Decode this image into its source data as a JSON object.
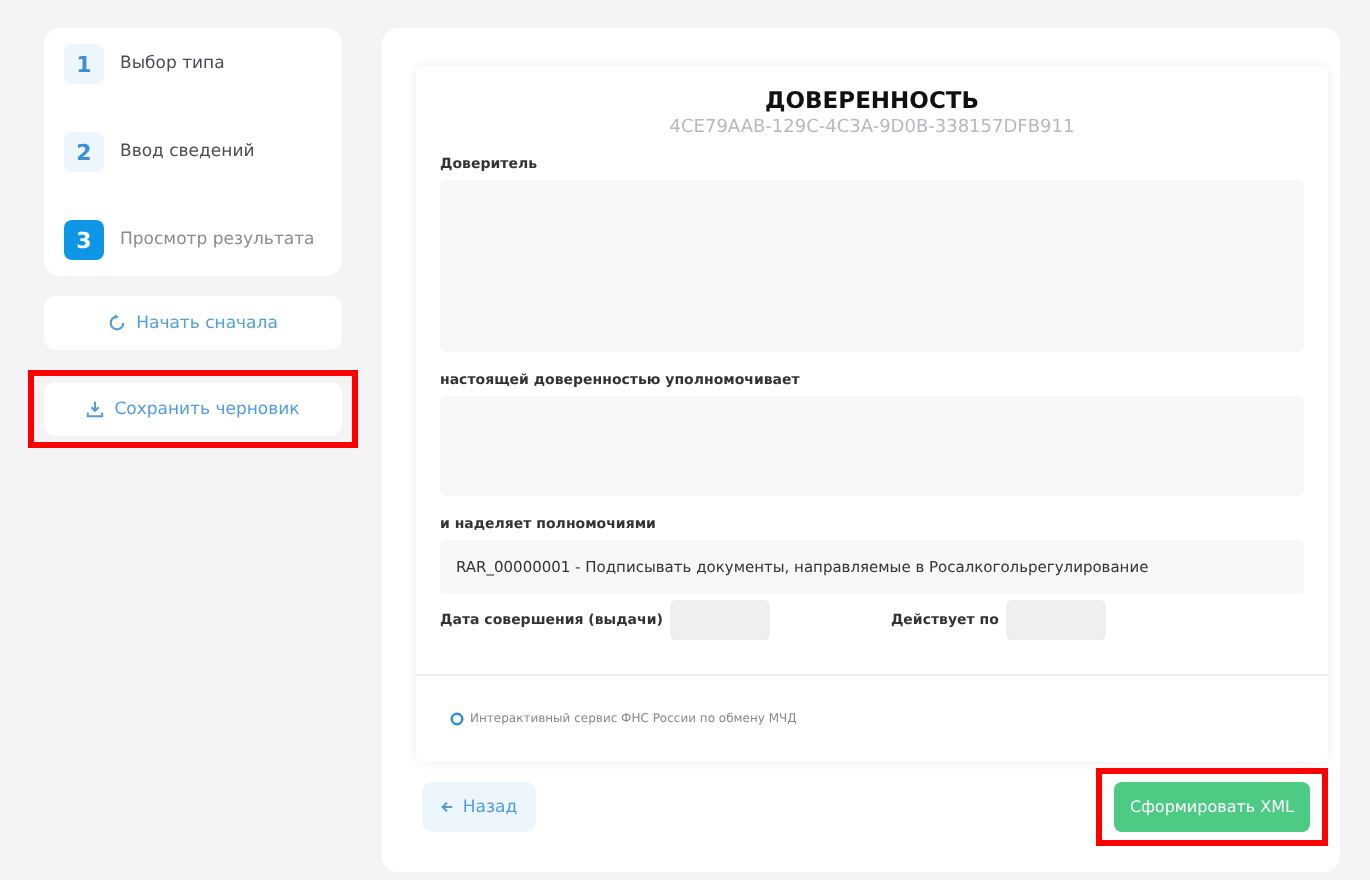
{
  "steps": [
    {
      "number": "1",
      "label": "Выбор типа",
      "selected": false
    },
    {
      "number": "2",
      "label": "Ввод сведений",
      "selected": false
    },
    {
      "number": "3",
      "label": "Просмотр результата",
      "selected": true
    }
  ],
  "side_buttons": [
    {
      "label": "Начать сначала",
      "highlighted": false
    },
    {
      "label": "Сохранить черновик",
      "highlighted": true
    }
  ],
  "document": {
    "title": "ДОВЕРЕННОСТЬ",
    "id": "4CE79AAB-129C-4C3A-9D0B-338157DFB911",
    "principal_label": "Доверитель",
    "authorizes_label": "настоящей доверенностью уполномочивает",
    "powers_label": "и наделяет полномочиями",
    "powers_value": "RAR_00000001 - Подписывать документы, направляемые в Росалкогольрегулирование",
    "date_label": "Дата совершения (выдачи)",
    "valid_label": "Действует по",
    "footer_note": "Интерактивный сервис ФНС России по обмену МЧД"
  },
  "back_button": {
    "label": "Назад",
    "highlighted": false
  },
  "submit_button": {
    "label": "Сформировать XML",
    "highlighted": true
  }
}
